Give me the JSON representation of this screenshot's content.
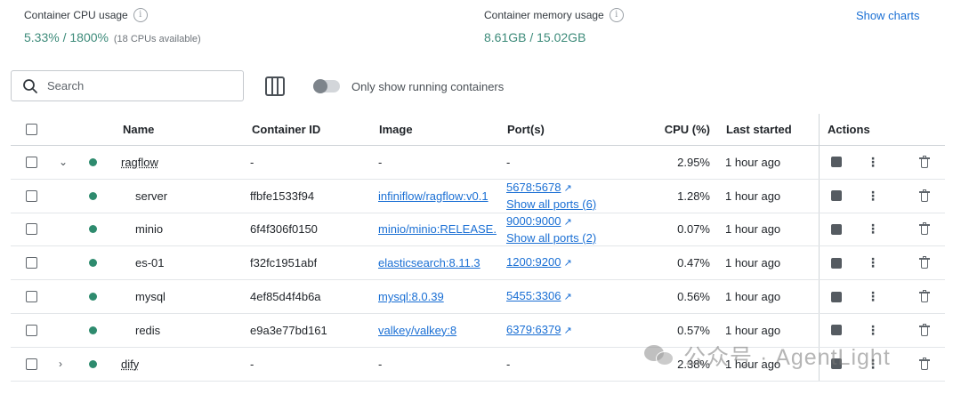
{
  "stats": {
    "cpu_label": "Container CPU usage",
    "cpu_value": "5.33% / 1800%",
    "cpu_note": "(18 CPUs available)",
    "mem_label": "Container memory usage",
    "mem_value": "8.61GB / 15.02GB",
    "show_charts": "Show charts"
  },
  "toolbar": {
    "search_placeholder": "Search",
    "toggle_label": "Only show running containers"
  },
  "table": {
    "headers": {
      "name": "Name",
      "container_id": "Container ID",
      "image": "Image",
      "ports": "Port(s)",
      "cpu": "CPU (%)",
      "last_started": "Last started",
      "actions": "Actions"
    },
    "rows": [
      {
        "name": "ragflow",
        "id": "-",
        "image": "-",
        "port": "-",
        "port_more": "",
        "cpu": "2.95%",
        "last": "1 hour ago"
      },
      {
        "name": "server",
        "id": "ffbfe1533f94",
        "image": "infiniflow/ragflow:v0.1",
        "port": "5678:5678",
        "port_more": "Show all ports (6)",
        "cpu": "1.28%",
        "last": "1 hour ago"
      },
      {
        "name": "minio",
        "id": "6f4f306f0150",
        "image": "minio/minio:RELEASE.",
        "port": "9000:9000",
        "port_more": "Show all ports (2)",
        "cpu": "0.07%",
        "last": "1 hour ago"
      },
      {
        "name": "es-01",
        "id": "f32fc1951abf",
        "image": "elasticsearch:8.11.3",
        "port": "1200:9200",
        "port_more": "",
        "cpu": "0.47%",
        "last": "1 hour ago"
      },
      {
        "name": "mysql",
        "id": "4ef85d4f4b6a",
        "image": "mysql:8.0.39",
        "port": "5455:3306",
        "port_more": "",
        "cpu": "0.56%",
        "last": "1 hour ago"
      },
      {
        "name": "redis",
        "id": "e9a3e77bd161",
        "image": "valkey/valkey:8",
        "port": "6379:6379",
        "port_more": "",
        "cpu": "0.57%",
        "last": "1 hour ago"
      },
      {
        "name": "dify",
        "id": "-",
        "image": "-",
        "port": "-",
        "port_more": "",
        "cpu": "2.38%",
        "last": "1 hour ago"
      }
    ]
  },
  "watermark": "公众号 · AgentLight",
  "icons": {
    "info": "info-icon",
    "search": "search-icon",
    "columns": "columns-icon",
    "expand": "chevron-icon",
    "status": "running-status-dot",
    "external": "external-link-icon",
    "stop": "stop-icon",
    "more": "kebab-menu-icon",
    "delete": "trash-icon"
  },
  "colors": {
    "accent_link": "#1a6fd4",
    "running_green": "#2e8b6e",
    "stat_green": "#3d8b7a"
  }
}
